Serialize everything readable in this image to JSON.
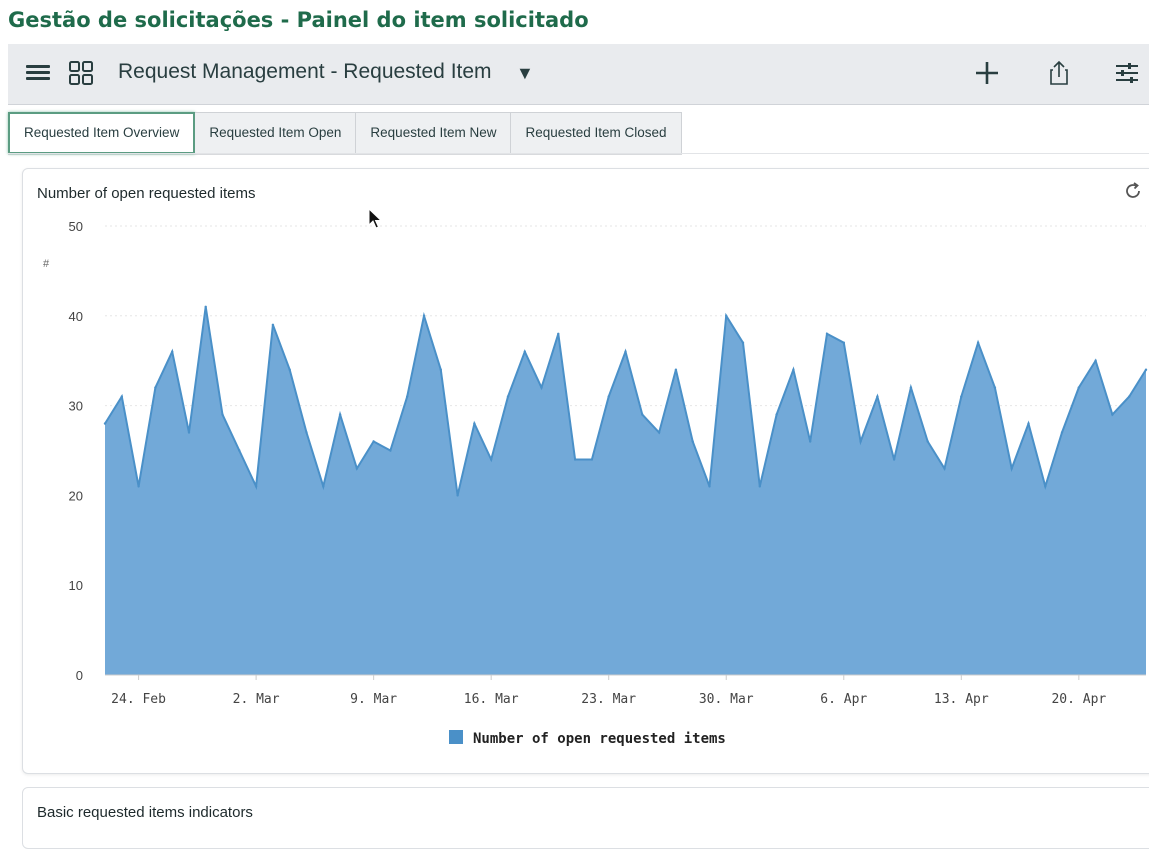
{
  "caption": "Gestão de solicitações - Painel do item solicitado",
  "header": {
    "title": "Request Management - Requested Item",
    "icons": [
      "menu-icon",
      "grid-icon",
      "chevron-down-icon",
      "plus-icon",
      "share-icon",
      "filter-icon"
    ]
  },
  "tabs": [
    {
      "label": "Requested Item Overview",
      "active": true
    },
    {
      "label": "Requested Item Open",
      "active": false
    },
    {
      "label": "Requested Item New",
      "active": false
    },
    {
      "label": "Requested Item Closed",
      "active": false
    }
  ],
  "colors": {
    "accent": "#5b9c82",
    "series": "#4a90c8",
    "area": "#72a9d8"
  },
  "chart_data": {
    "type": "area",
    "title": "Number of open requested items",
    "ylabel": "#",
    "ylim": [
      0,
      50
    ],
    "yticks": [
      0,
      10,
      20,
      30,
      40,
      50
    ],
    "xticks": [
      "24. Feb",
      "2. Mar",
      "9. Mar",
      "16. Mar",
      "23. Mar",
      "30. Mar",
      "6. Apr",
      "13. Apr",
      "20. Apr"
    ],
    "x_start": "22. Feb",
    "grid": true,
    "legend": "bottom",
    "series": [
      {
        "name": "Number of open requested items",
        "values": [
          28,
          31,
          21,
          32,
          36,
          27,
          41,
          29,
          25,
          21,
          39,
          34,
          27,
          21,
          29,
          23,
          26,
          25,
          31,
          40,
          34,
          20,
          28,
          24,
          31,
          36,
          32,
          38,
          24,
          24,
          31,
          36,
          29,
          27,
          34,
          26,
          21,
          40,
          37,
          21,
          29,
          34,
          26,
          38,
          37,
          26,
          31,
          24,
          32,
          26,
          23,
          31,
          37,
          32,
          23,
          28,
          21,
          27,
          32,
          35,
          29,
          31,
          34
        ]
      }
    ]
  },
  "card2": {
    "title": "Basic requested items indicators"
  }
}
